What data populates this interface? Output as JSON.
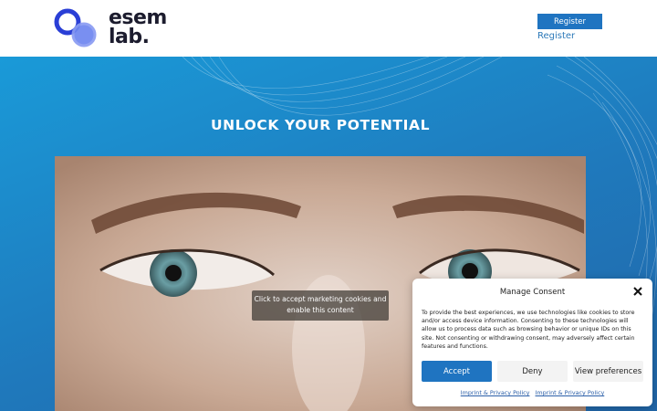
{
  "header": {
    "logo_line1": "esem",
    "logo_line2": "lab.",
    "register_button": "Register",
    "register_link": "Register"
  },
  "hero": {
    "title": "UNLOCK YOUR POTENTIAL",
    "cookie_overlay_line1": "Click to accept marketing cookies and",
    "cookie_overlay_line2": "enable this content"
  },
  "consent": {
    "title": "Manage Consent",
    "text": "To provide the best experiences, we use technologies like cookies to store and/or access device information. Consenting to these technologies will allow us to process data such as browsing behavior or unique IDs on this site. Not consenting or withdrawing consent, may adversely affect certain features and functions.",
    "accept_label": "Accept",
    "deny_label": "Deny",
    "view_label": "View preferences",
    "link1": "Imprint & Privacy Policy",
    "link2": "Imprint & Privacy Policy"
  },
  "colors": {
    "brand_blue": "#1f74c1",
    "hero_blue": "#1a9ad8",
    "logo_dark": "#1c1c2e"
  }
}
